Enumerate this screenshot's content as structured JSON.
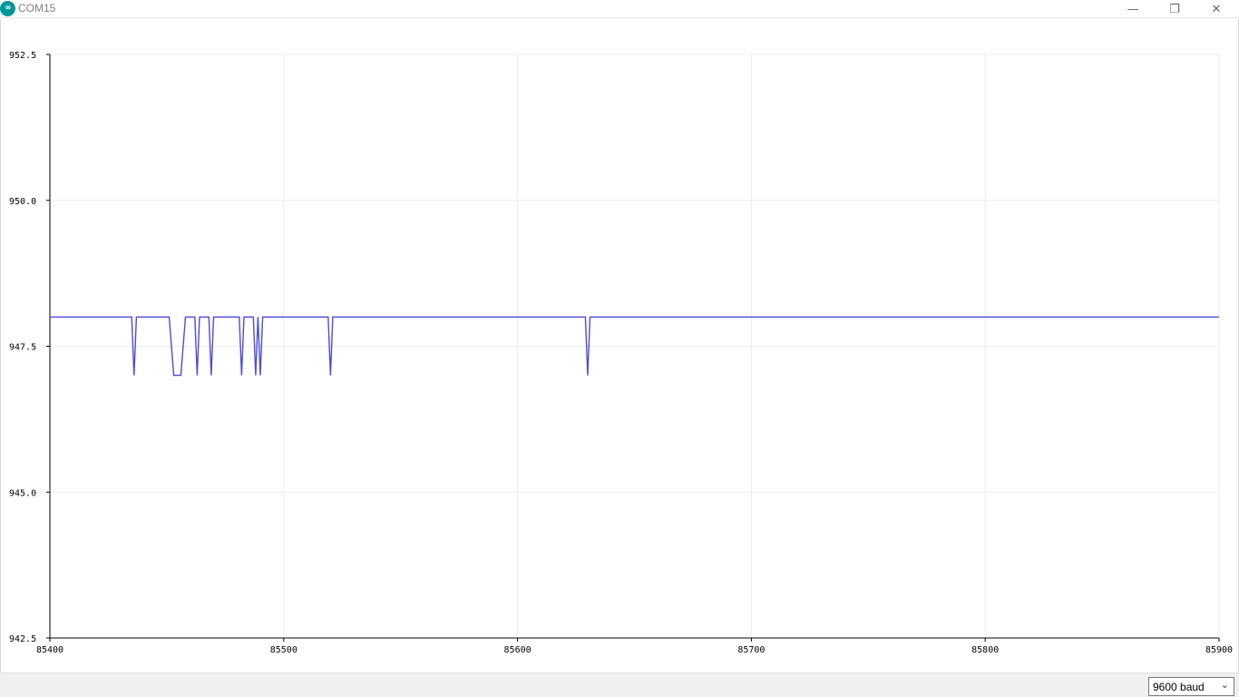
{
  "window": {
    "title": "COM15",
    "icon": "arduino-logo-icon",
    "icon_glyph": "∞",
    "controls": {
      "minimize": "—",
      "maximize": "❐",
      "close": "✕"
    }
  },
  "colors": {
    "series": "#4b4bdc",
    "grid": "#ececf2",
    "axis": "#000000",
    "accent": "#00979c"
  },
  "chart_data": {
    "type": "line",
    "xlim": [
      85400,
      85900
    ],
    "ylim": [
      942.5,
      952.5
    ],
    "xticks": [
      "85400",
      "85500",
      "85600",
      "85700",
      "85800",
      "85900"
    ],
    "yticks": [
      "952.5",
      "950.0",
      "947.5",
      "945.0",
      "942.5"
    ],
    "grid": true,
    "series": [
      {
        "values_x": [
          85400,
          85435,
          85436,
          85437,
          85451,
          85453,
          85456,
          85458,
          85462,
          85463,
          85464,
          85468,
          85469,
          85470,
          85481,
          85482,
          85483,
          85487,
          85488,
          85489,
          85490,
          85491,
          85519,
          85520,
          85521,
          85629,
          85630,
          85631,
          85900
        ],
        "values_y": [
          948,
          948,
          947,
          948,
          948,
          947,
          947,
          948,
          948,
          947,
          948,
          948,
          947,
          948,
          948,
          947,
          948,
          948,
          947,
          948,
          947,
          948,
          948,
          947,
          948,
          948,
          947,
          948,
          948
        ]
      }
    ]
  },
  "footer": {
    "baud": "9600 baud",
    "baud_icon": "chevron-down-icon"
  }
}
